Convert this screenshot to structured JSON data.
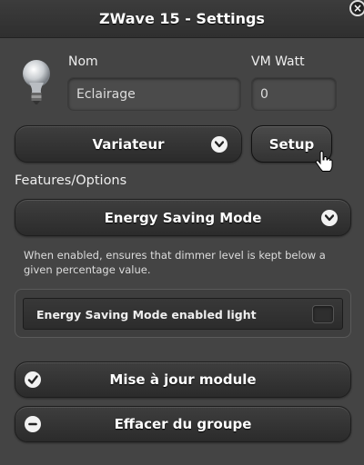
{
  "window": {
    "title": "ZWave 15 - Settings",
    "close_glyph": "×"
  },
  "device": {
    "icon": "lightbulb-icon",
    "nom_label": "Nom",
    "nom_value": "Eclairage",
    "vm_label": "VM Watt",
    "vm_value": "0"
  },
  "type_select": {
    "value": "Variateur",
    "icon": "chevron-down-icon"
  },
  "setup_button": {
    "label": "Setup"
  },
  "features": {
    "label": "Features/Options",
    "selected": "Energy Saving Mode",
    "icon": "chevron-down-icon",
    "description": "When enabled, ensures that dimmer level is kept below a given percentage value.",
    "switch_label": "Energy Saving Mode enabled light",
    "switch_on": false
  },
  "actions": {
    "update_label": "Mise à jour module",
    "update_icon": "check-icon",
    "remove_label": "Effacer du groupe",
    "remove_icon": "minus-icon"
  },
  "colors": {
    "background": "#444444",
    "button_dark": "#2f2f2f",
    "icon_bg": "#f2f2f2"
  }
}
